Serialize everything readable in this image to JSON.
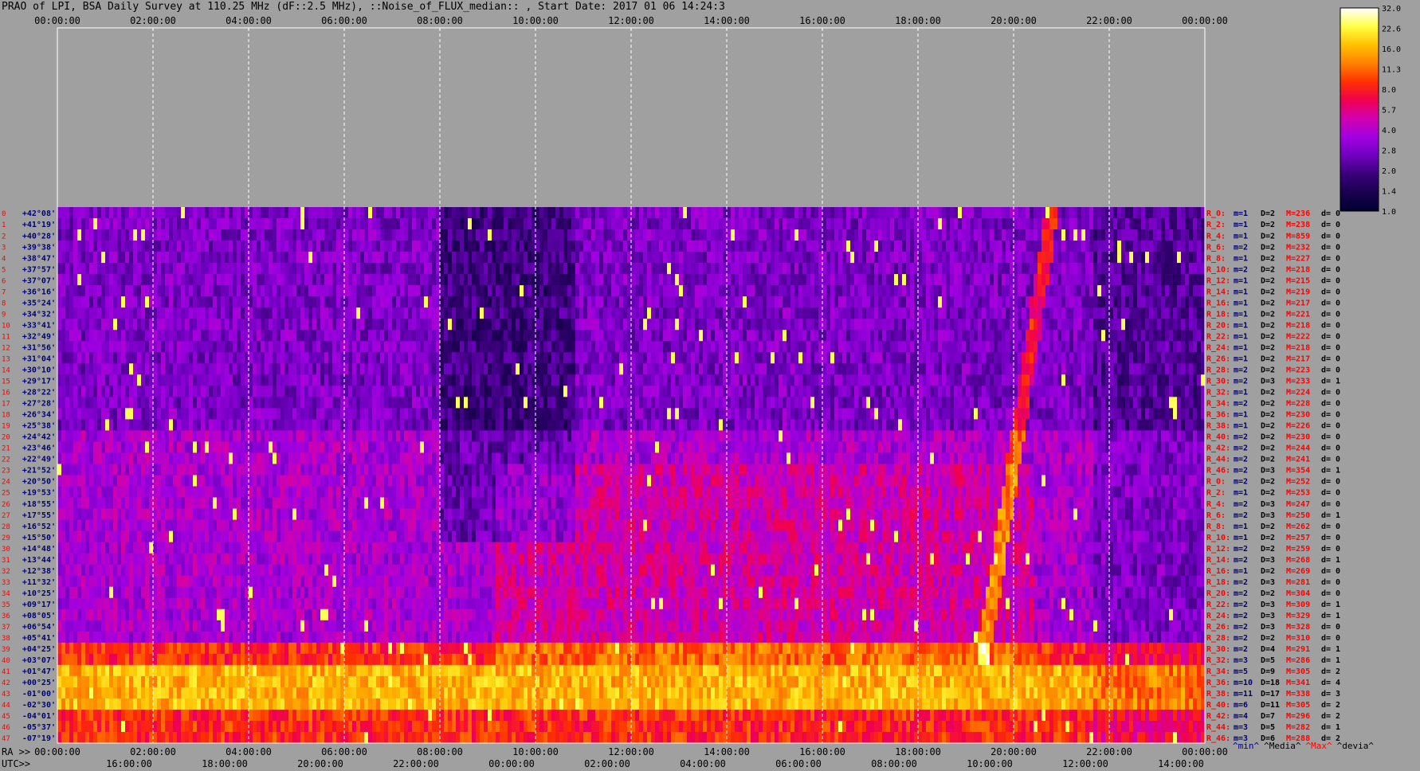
{
  "title": "PRAO of LPI, BSA Daily Survey at 110.25 MHz (dF::2.5 MHz), ::Noise_of_FLUX_median:: , Start Date: 2017 01 06 14:24:3",
  "ra_prefix": "RA >>",
  "utc_prefix": "UTC>>",
  "legend_keys": [
    {
      "text": "^min^",
      "color": "#00007a"
    },
    {
      "text": "^Media^",
      "color": "#000000"
    },
    {
      "text": "^Max^",
      "color": "#ff0000"
    },
    {
      "text": "^devia^",
      "color": "#000000"
    }
  ],
  "chart_data": {
    "type": "heatmap",
    "x_top_ticks": [
      "00:00:00",
      "02:00:00",
      "04:00:00",
      "06:00:00",
      "08:00:00",
      "10:00:00",
      "12:00:00",
      "14:00:00",
      "16:00:00",
      "18:00:00",
      "20:00:00",
      "22:00:00",
      "00:00:00"
    ],
    "x_ra_ticks": [
      "00:00:00",
      "02:00:00",
      "04:00:00",
      "06:00:00",
      "08:00:00",
      "10:00:00",
      "12:00:00",
      "14:00:00",
      "16:00:00",
      "18:00:00",
      "20:00:00",
      "22:00:00",
      "00:00:00"
    ],
    "x_utc_ticks": [
      "16:00:00",
      "18:00:00",
      "20:00:00",
      "22:00:00",
      "00:00:00",
      "02:00:00",
      "04:00:00",
      "06:00:00",
      "08:00:00",
      "10:00:00",
      "12:00:00",
      "14:00:00"
    ],
    "y_dec_labels": [
      "+42°08'",
      "+41°19'",
      "+40°28'",
      "+39°38'",
      "+38°47'",
      "+37°57'",
      "+37°07'",
      "+36°16'",
      "+35°24'",
      "+34°32'",
      "+33°41'",
      "+32°49'",
      "+31°56'",
      "+31°04'",
      "+30°10'",
      "+29°17'",
      "+28°22'",
      "+27°28'",
      "+26°34'",
      "+25°38'",
      "+24°42'",
      "+23°46'",
      "+22°49'",
      "+21°52'",
      "+20°50'",
      "+19°53'",
      "+18°55'",
      "+17°55'",
      "+16°52'",
      "+15°50'",
      "+14°48'",
      "+13°44'",
      "+12°38'",
      "+11°32'",
      "+10°25'",
      "+09°17'",
      "+08°05'",
      "+06°54'",
      "+05°41'",
      "+04°25'",
      "+03°07'",
      "+01°47'",
      "+00°25'",
      "-01°00'",
      "-02°30'",
      "-04°01'",
      "-05°37'",
      "-07°19'"
    ],
    "y_index_labels": [
      "0",
      "1",
      "2",
      "3",
      "4",
      "5",
      "6",
      "7",
      "8",
      "9",
      "10",
      "11",
      "12",
      "13",
      "14",
      "15",
      "16",
      "17",
      "18",
      "19",
      "20",
      "21",
      "22",
      "23",
      "24",
      "25",
      "26",
      "27",
      "28",
      "29",
      "30",
      "31",
      "32",
      "33",
      "34",
      "35",
      "36",
      "37",
      "38",
      "39",
      "40",
      "41",
      "42",
      "43",
      "44",
      "45",
      "46",
      "47"
    ],
    "row_stats": [
      {
        "r": "R_0:",
        "m": "m=1",
        "d": "D=2",
        "M": "M=236",
        "dv": "d= 0"
      },
      {
        "r": "R_2:",
        "m": "m=1",
        "d": "D=2",
        "M": "M=238",
        "dv": "d= 0"
      },
      {
        "r": "R_4:",
        "m": "m=1",
        "d": "D=2",
        "M": "M=859",
        "dv": "d= 0"
      },
      {
        "r": "R_6:",
        "m": "m=2",
        "d": "D=2",
        "M": "M=232",
        "dv": "d= 0"
      },
      {
        "r": "R_8:",
        "m": "m=1",
        "d": "D=2",
        "M": "M=227",
        "dv": "d= 0"
      },
      {
        "r": "R_10:",
        "m": "m=2",
        "d": "D=2",
        "M": "M=218",
        "dv": "d= 0"
      },
      {
        "r": "R_12:",
        "m": "m=1",
        "d": "D=2",
        "M": "M=215",
        "dv": "d= 0"
      },
      {
        "r": "R_14:",
        "m": "m=1",
        "d": "D=2",
        "M": "M=219",
        "dv": "d= 0"
      },
      {
        "r": "R_16:",
        "m": "m=1",
        "d": "D=2",
        "M": "M=217",
        "dv": "d= 0"
      },
      {
        "r": "R_18:",
        "m": "m=1",
        "d": "D=2",
        "M": "M=221",
        "dv": "d= 0"
      },
      {
        "r": "R_20:",
        "m": "m=1",
        "d": "D=2",
        "M": "M=218",
        "dv": "d= 0"
      },
      {
        "r": "R_22:",
        "m": "m=1",
        "d": "D=2",
        "M": "M=222",
        "dv": "d= 0"
      },
      {
        "r": "R_24:",
        "m": "m=1",
        "d": "D=2",
        "M": "M=218",
        "dv": "d= 0"
      },
      {
        "r": "R_26:",
        "m": "m=1",
        "d": "D=2",
        "M": "M=217",
        "dv": "d= 0"
      },
      {
        "r": "R_28:",
        "m": "m=2",
        "d": "D=2",
        "M": "M=223",
        "dv": "d= 0"
      },
      {
        "r": "R_30:",
        "m": "m=2",
        "d": "D=3",
        "M": "M=233",
        "dv": "d= 1"
      },
      {
        "r": "R_32:",
        "m": "m=1",
        "d": "D=2",
        "M": "M=224",
        "dv": "d= 0"
      },
      {
        "r": "R_34:",
        "m": "m=2",
        "d": "D=2",
        "M": "M=228",
        "dv": "d= 0"
      },
      {
        "r": "R_36:",
        "m": "m=1",
        "d": "D=2",
        "M": "M=230",
        "dv": "d= 0"
      },
      {
        "r": "R_38:",
        "m": "m=1",
        "d": "D=2",
        "M": "M=226",
        "dv": "d= 0"
      },
      {
        "r": "R_40:",
        "m": "m=2",
        "d": "D=2",
        "M": "M=230",
        "dv": "d= 0"
      },
      {
        "r": "R_42:",
        "m": "m=2",
        "d": "D=2",
        "M": "M=244",
        "dv": "d= 0"
      },
      {
        "r": "R_44:",
        "m": "m=2",
        "d": "D=2",
        "M": "M=241",
        "dv": "d= 0"
      },
      {
        "r": "R_46:",
        "m": "m=2",
        "d": "D=3",
        "M": "M=354",
        "dv": "d= 1"
      },
      {
        "r": "R_0:",
        "m": "m=2",
        "d": "D=2",
        "M": "M=252",
        "dv": "d= 0"
      },
      {
        "r": "R_2:",
        "m": "m=1",
        "d": "D=2",
        "M": "M=253",
        "dv": "d= 0"
      },
      {
        "r": "R_4:",
        "m": "m=2",
        "d": "D=3",
        "M": "M=247",
        "dv": "d= 0"
      },
      {
        "r": "R_6:",
        "m": "m=2",
        "d": "D=3",
        "M": "M=250",
        "dv": "d= 1"
      },
      {
        "r": "R_8:",
        "m": "m=1",
        "d": "D=2",
        "M": "M=262",
        "dv": "d= 0"
      },
      {
        "r": "R_10:",
        "m": "m=1",
        "d": "D=2",
        "M": "M=257",
        "dv": "d= 0"
      },
      {
        "r": "R_12:",
        "m": "m=2",
        "d": "D=2",
        "M": "M=259",
        "dv": "d= 0"
      },
      {
        "r": "R_14:",
        "m": "m=2",
        "d": "D=3",
        "M": "M=268",
        "dv": "d= 1"
      },
      {
        "r": "R_16:",
        "m": "m=1",
        "d": "D=2",
        "M": "M=269",
        "dv": "d= 0"
      },
      {
        "r": "R_18:",
        "m": "m=2",
        "d": "D=3",
        "M": "M=281",
        "dv": "d= 0"
      },
      {
        "r": "R_20:",
        "m": "m=2",
        "d": "D=2",
        "M": "M=304",
        "dv": "d= 0"
      },
      {
        "r": "R_22:",
        "m": "m=2",
        "d": "D=3",
        "M": "M=309",
        "dv": "d= 1"
      },
      {
        "r": "R_24:",
        "m": "m=2",
        "d": "D=3",
        "M": "M=329",
        "dv": "d= 1"
      },
      {
        "r": "R_26:",
        "m": "m=2",
        "d": "D=3",
        "M": "M=328",
        "dv": "d= 0"
      },
      {
        "r": "R_28:",
        "m": "m=2",
        "d": "D=2",
        "M": "M=310",
        "dv": "d= 0"
      },
      {
        "r": "R_30:",
        "m": "m=2",
        "d": "D=4",
        "M": "M=291",
        "dv": "d= 1"
      },
      {
        "r": "R_32:",
        "m": "m=3",
        "d": "D=5",
        "M": "M=286",
        "dv": "d= 1"
      },
      {
        "r": "R_34:",
        "m": "m=5",
        "d": "D=9",
        "M": "M=305",
        "dv": "d= 2"
      },
      {
        "r": "R_36:",
        "m": "m=10",
        "d": "D=18",
        "M": "M=341",
        "dv": "d= 4"
      },
      {
        "r": "R_38:",
        "m": "m=11",
        "d": "D=17",
        "M": "M=338",
        "dv": "d= 3"
      },
      {
        "r": "R_40:",
        "m": "m=6",
        "d": "D=11",
        "M": "M=305",
        "dv": "d= 2"
      },
      {
        "r": "R_42:",
        "m": "m=4",
        "d": "D=7",
        "M": "M=296",
        "dv": "d= 2"
      },
      {
        "r": "R_44:",
        "m": "m=3",
        "d": "D=5",
        "M": "M=282",
        "dv": "d= 1"
      },
      {
        "r": "R_46:",
        "m": "m=3",
        "d": "D=6",
        "M": "M=288",
        "dv": "d= 2"
      }
    ],
    "colorbar": {
      "labels": [
        "32.0",
        "22.6",
        "16.0",
        "11.3",
        "8.0",
        "5.7",
        "4.0",
        "2.8",
        "2.0",
        "1.4",
        "1.0"
      ],
      "scale": "log",
      "range": [
        1.0,
        32.0
      ],
      "colors": [
        "#000030",
        "#1a0050",
        "#3a007a",
        "#7000c0",
        "#a000e0",
        "#d000b0",
        "#f00050",
        "#ff3000",
        "#ff8000",
        "#ffc000",
        "#ffff40",
        "#ffffff"
      ]
    },
    "row_tick_colors": {
      "stat_label": "#ff0000",
      "min": "#00007a",
      "dec_label": "#00007a",
      "index_label": "#ff0000"
    },
    "background": "#a0a0a0"
  }
}
